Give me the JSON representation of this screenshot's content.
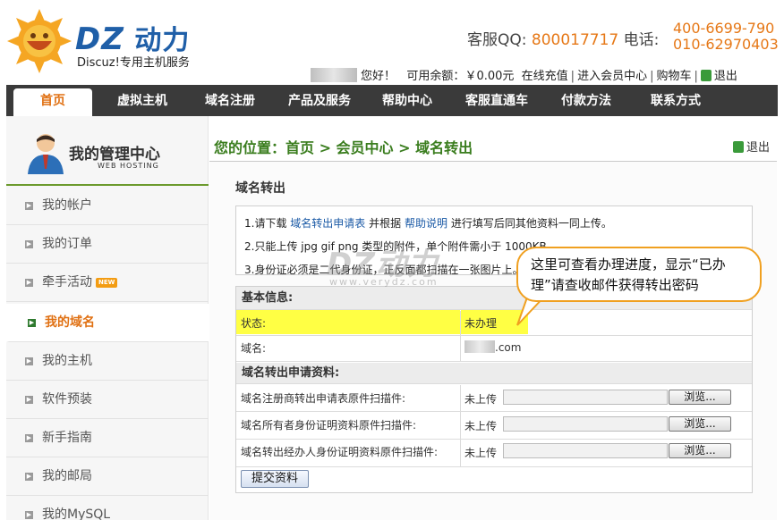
{
  "header": {
    "brand_dz": "DZ",
    "brand_cn": "动力",
    "slogan": "Discuz!专用主机服务",
    "qq_label": "客服QQ:",
    "qq_number": "800017717",
    "phone_label": "电话:",
    "phone1": "400-6699-790",
    "phone2": "010-62970403"
  },
  "userbar": {
    "greeting": "您好！",
    "balance_label": "可用余额：",
    "balance": "￥0.00元",
    "recharge": "在线充值",
    "member_center": "进入会员中心",
    "cart": "购物车",
    "logout": "退出"
  },
  "nav": {
    "items": [
      "首页",
      "虚拟主机",
      "域名注册",
      "产品及服务",
      "帮助中心",
      "客服直通车",
      "付款方法",
      "联系方式"
    ]
  },
  "sidebar": {
    "title": "我的管理中心",
    "subtitle": "WEB HOSTING",
    "items": [
      "我的帐户",
      "我的订单",
      "牵手活动",
      "我的域名",
      "我的主机",
      "软件预装",
      "新手指南",
      "我的邮局",
      "我的MySQL"
    ],
    "new_badge": "NEW"
  },
  "main": {
    "location": "您的位置：首页 > 会员中心 > 域名转出",
    "logout": "退出",
    "section_title": "域名转出",
    "notice": {
      "line1_pre": "1.请下载",
      "line1_link1": "域名转出申请表",
      "line1_mid": "并根据",
      "line1_link2": "帮助说明",
      "line1_post": "进行填写后同其他资料一同上传。",
      "line2": "2.只能上传 jpg gif png 类型的附件，单个附件需小于 1000KB。",
      "line3": "3.身份证必须是二代身份证，正反面都扫描在一张图片上。"
    },
    "basic_header": "基本信息:",
    "status_label": "状态:",
    "status_value": "未办理",
    "domain_label": "域名:",
    "domain_suffix": ".com",
    "apply_header": "域名转出申请资料:",
    "uploads": [
      {
        "label": "域名注册商转出申请表原件扫描件:",
        "state": "未上传",
        "button": "浏览..."
      },
      {
        "label": "域名所有者身份证明资料原件扫描件:",
        "state": "未上传",
        "button": "浏览..."
      },
      {
        "label": "域名转出经办人身份证明资料原件扫描件:",
        "state": "未上传",
        "button": "浏览..."
      }
    ],
    "submit": "提交资料"
  },
  "watermark": {
    "main": "DZ动力",
    "sub": "www.verydz.com"
  },
  "callout": "这里可查看办理进度，显示“已办理”请查收邮件获得转出密码",
  "colors": {
    "accent": "#e67817",
    "brand_blue": "#1f5fa8",
    "nav_bg": "#3a3a3a",
    "location_green": "#3a7d1e",
    "highlight": "#ffff44"
  }
}
